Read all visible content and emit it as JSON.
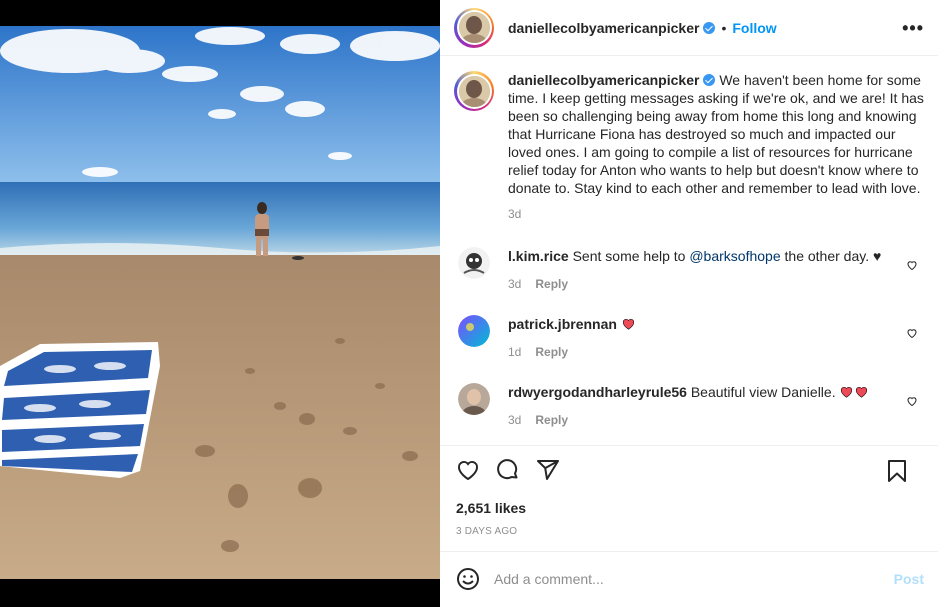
{
  "post": {
    "username": "daniellecolbyamericanpicker",
    "follow_label": "Follow",
    "dot": "•",
    "more_label": "•••"
  },
  "caption": {
    "username": "daniellecolbyamericanpicker",
    "text": "We haven't been home for some time. I keep getting messages asking if we're ok, and we are! It has been so challenging being away from home this long and knowing that Hurricane Fiona has destroyed so much and impacted our loved ones. I am going to compile a list of resources for hurricane relief today for Anton who wants to help but doesn't know where to donate to. Stay kind to each other and remember to lead with love.",
    "age": "3d"
  },
  "comments": [
    {
      "username": "l.kim.rice",
      "text_before": "Sent some help to",
      "mention": "@barksofhope",
      "text_after": "the other day. ♥",
      "age": "3d",
      "reply_label": "Reply"
    },
    {
      "username": "patrick.jbrennan",
      "text": "",
      "age": "1d",
      "reply_label": "Reply"
    },
    {
      "username": "rdwyergodandharleyrule56",
      "text": "Beautiful view Danielle.",
      "age": "3d",
      "reply_label": "Reply"
    }
  ],
  "engagement": {
    "likes": "2,651 likes",
    "timestamp": "3 DAYS AGO"
  },
  "composer": {
    "placeholder": "Add a comment...",
    "post_label": "Post"
  },
  "icons": [
    "like-icon",
    "comment-icon",
    "share-icon",
    "bookmark-icon",
    "emoji-icon",
    "more-icon",
    "verified-icon",
    "comment-like-icon"
  ],
  "colors": {
    "follow": "#0095f6",
    "verified": "#3897f0",
    "heart_red": "#ed4956",
    "secondary_text": "#8e8e8e",
    "post_disabled": "#b2dffc"
  }
}
